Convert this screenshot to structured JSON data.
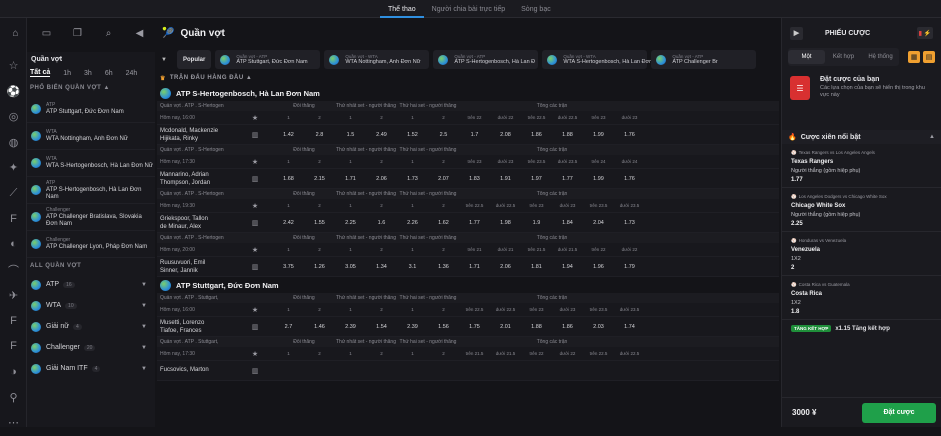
{
  "top_tabs": [
    "Thể thao",
    "Người chia bài trực tiếp",
    "Sòng bạc"
  ],
  "top_icons": [
    "home-icon",
    "live-icon",
    "copy-icon",
    "search-icon",
    "collapse-icon"
  ],
  "rail_icons": [
    "star-icon",
    "soccer-icon",
    "tennis-icon",
    "basketball-icon",
    "esports-icon",
    "hockey-icon",
    "fifa-icon",
    "volleyball-icon",
    "baseball-icon",
    "badminton-icon",
    "fifa2-icon",
    "fifa3-icon",
    "pingpong-icon",
    "cricket-icon",
    "more-icon"
  ],
  "sidebar": {
    "title": "Quần vợt",
    "tabs": [
      "Tất cả",
      "1h",
      "3h",
      "6h",
      "24h"
    ],
    "popular_title": "PHỔ BIẾN QUẦN VỢT",
    "popular": [
      {
        "cat": "ATP",
        "name": "ATP Stuttgart, Đức Đơn Nam"
      },
      {
        "cat": "WTA",
        "name": "WTA Nottingham, Anh Đơn Nữ"
      },
      {
        "cat": "WTA",
        "name": "WTA S-Hertogenbosch, Hà Lan Đơn Nữ"
      },
      {
        "cat": "ATP",
        "name": "ATP S-Hertogenbosch, Hà Lan Đơn Nam"
      },
      {
        "cat": "Challenger",
        "name": "ATP Challenger Bratislava, Slovakia Đơn Nam"
      },
      {
        "cat": "Challenger",
        "name": "ATP Challenger Lyon, Pháp Đơn Nam"
      }
    ],
    "all_title": "ALL QUẦN VỢT",
    "all": [
      {
        "name": "ATP",
        "count": "16"
      },
      {
        "name": "WTA",
        "count": "10"
      },
      {
        "name": "Giải nữ",
        "count": "4"
      },
      {
        "name": "Challenger",
        "count": "20"
      },
      {
        "name": "Giải Nam ITF",
        "count": "4"
      }
    ]
  },
  "main": {
    "title": "Quần vợt",
    "popular_label": "Popular",
    "fav_cards": [
      {
        "cat": "Quần vợt - ATP",
        "name": "ATP Stuttgart, Đức Đơn Nam"
      },
      {
        "cat": "Quần vợt - WTA",
        "name": "WTA Nottingham, Anh Đơn Nữ"
      },
      {
        "cat": "Quần vợt - ATP",
        "name": "ATP S-Hertogenbosch, Hà Lan Đ"
      },
      {
        "cat": "Quần vợt - WTA",
        "name": "WTA S-Hertogenbosch, Hà Lan Đơn"
      },
      {
        "cat": "Quần vợt - ATP",
        "name": "ATP Challenger Br"
      }
    ],
    "section": "TRẬN ĐẤU HÀNG ĐẦU",
    "tournaments": [
      {
        "name": "ATP S-Hertogenbosch, Hà Lan Đơn Nam",
        "matches": [
          {
            "crumb": "Quần vợt . ATP . S-Hertogen",
            "time": "Hôm nay, 16:00",
            "p1": "Mcdonald, Mackenzie",
            "p2": "Hijikata, Rinky",
            "h": [
              "1",
              "2",
              "1",
              "2",
              "1",
              "2",
              "trên 22",
              "dưới 22",
              "trên 22.5",
              "dưới 22.5",
              "trên 23",
              "dưới 23"
            ],
            "o": [
              "1.42",
              "2.8",
              "1.5",
              "2.49",
              "1.52",
              "2.5",
              "1.7",
              "2.08",
              "1.86",
              "1.88",
              "1.99",
              "1.76"
            ]
          },
          {
            "crumb": "Quần vợt . ATP . S-Hertogen",
            "time": "Hôm nay, 17:30",
            "p1": "Mannarino, Adrian",
            "p2": "Thompson, Jordan",
            "h": [
              "1",
              "2",
              "1",
              "2",
              "1",
              "2",
              "trên 23",
              "dưới 23",
              "trên 23.5",
              "dưới 23.5",
              "trên 24",
              "dưới 24"
            ],
            "o": [
              "1.68",
              "2.15",
              "1.71",
              "2.06",
              "1.73",
              "2.07",
              "1.83",
              "1.91",
              "1.97",
              "1.77",
              "1.99",
              "1.76"
            ]
          },
          {
            "crumb": "Quần vợt . ATP . S-Hertogen",
            "time": "Hôm nay, 19:30",
            "p1": "Griekspoor, Tallon",
            "p2": "de Minaur, Alex",
            "h": [
              "1",
              "2",
              "1",
              "2",
              "1",
              "2",
              "trên 22.5",
              "dưới 22.5",
              "trên 23",
              "dưới 23",
              "trên 23.5",
              "dưới 23.5"
            ],
            "o": [
              "2.42",
              "1.55",
              "2.25",
              "1.6",
              "2.26",
              "1.62",
              "1.77",
              "1.98",
              "1.9",
              "1.84",
              "2.04",
              "1.73"
            ]
          },
          {
            "crumb": "Quần vợt . ATP . S-Hertogen",
            "time": "Hôm nay, 20:00",
            "p1": "Ruusuvuori, Emil",
            "p2": "Sinner, Jannik",
            "h": [
              "1",
              "2",
              "1",
              "2",
              "1",
              "2",
              "trên 21",
              "dưới 21",
              "trên 21.5",
              "dưới 21.5",
              "trên 22",
              "dưới 22"
            ],
            "o": [
              "3.75",
              "1.26",
              "3.05",
              "1.34",
              "3.1",
              "1.36",
              "1.71",
              "2.06",
              "1.81",
              "1.94",
              "1.96",
              "1.79"
            ]
          }
        ]
      },
      {
        "name": "ATP Stuttgart, Đức Đơn Nam",
        "matches": [
          {
            "crumb": "Quần vợt . ATP . Stuttgart,",
            "time": "Hôm nay, 16:00",
            "p1": "Musetti, Lorenzo",
            "p2": "Tiafoe, Frances",
            "h": [
              "1",
              "2",
              "1",
              "2",
              "1",
              "2",
              "trên 22.5",
              "dưới 22.5",
              "trên 23",
              "dưới 23",
              "trên 23.5",
              "dưới 23.5"
            ],
            "o": [
              "2.7",
              "1.46",
              "2.39",
              "1.54",
              "2.39",
              "1.56",
              "1.75",
              "2.01",
              "1.88",
              "1.86",
              "2.03",
              "1.74"
            ]
          },
          {
            "crumb": "Quần vợt . ATP . Stuttgart,",
            "time": "Hôm nay, 17:30",
            "p1": "Fucsovics, Marton",
            "p2": "",
            "h": [
              "1",
              "2",
              "1",
              "2",
              "1",
              "2",
              "trên 21.5",
              "dưới 21.5",
              "trên 22",
              "dưới 22",
              "trên 22.5",
              "dưới 22.5"
            ],
            "o": [
              "",
              "",
              "",
              "",
              "",
              "",
              "",
              "",
              "",
              "",
              "",
              ""
            ]
          }
        ]
      }
    ],
    "col_head": {
      "winner": "Đối thắng",
      "set1": "Thứ nhất set - người thắng",
      "set2": "Thứ hai set - người thắng",
      "total": "Tổng các trận"
    }
  },
  "slip": {
    "title": "PHIẾU CƯỢC",
    "tabs": [
      "Một",
      "Kết hợp",
      "Hệ thống"
    ],
    "hint_title": "Đặt cược của bạn",
    "hint_text": "Các lựa chọn của bạn sẽ hiển thị trong khu vực này",
    "parlay_title": "Cược xiên nổi bật",
    "picks": [
      {
        "event": "Texas Rangers vs Los Angeles Angels",
        "pick": "Texas Rangers",
        "market": "Người thắng (gồm hiệp phụ)",
        "odds": "1.77"
      },
      {
        "event": "Los Angeles Dodgers vs Chicago White Sox",
        "pick": "Chicago White Sox",
        "market": "Người thắng (gồm hiệp phụ)",
        "odds": "2.25"
      },
      {
        "event": "Honduras vs Venezuela",
        "pick": "Venezuela",
        "market": "1X2",
        "odds": "2"
      },
      {
        "event": "Costa Rica vs Guatemala",
        "pick": "Costa Rica",
        "market": "1X2",
        "odds": "1.8"
      }
    ],
    "boost_badge": "TĂNG KẾT HỢP",
    "boost_text": "x1.15 Tăng kết hợp",
    "stake": "3000 ¥",
    "place": "Đặt cược"
  },
  "colors": {
    "accent": "#2f8fe0",
    "green": "#1fa04a",
    "bg": "#141418"
  }
}
